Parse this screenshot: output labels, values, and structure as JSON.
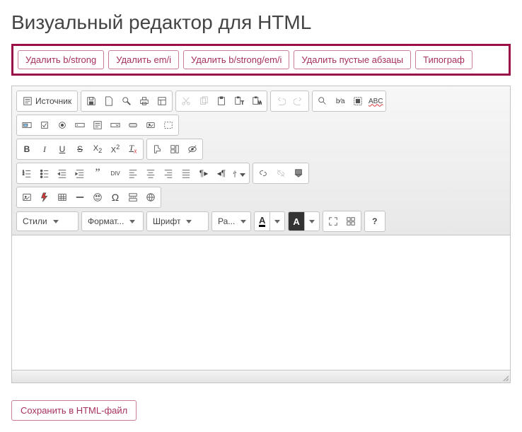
{
  "title": "Визуальный редактор для HTML",
  "actions": {
    "remove_b_strong": "Удалить b/strong",
    "remove_em_i": "Удалить em/i",
    "remove_all": "Удалить b/strong/em/i",
    "remove_empty": "Удалить пустые абзацы",
    "typograf": "Типограф"
  },
  "toolbar": {
    "source": "Источник"
  },
  "combos": {
    "style": "Стили",
    "format": "Формат...",
    "font": "Шрифт",
    "size": "Ра...",
    "textcolor": "A",
    "bgcolor": "A"
  },
  "save": "Сохранить в HTML-файл"
}
